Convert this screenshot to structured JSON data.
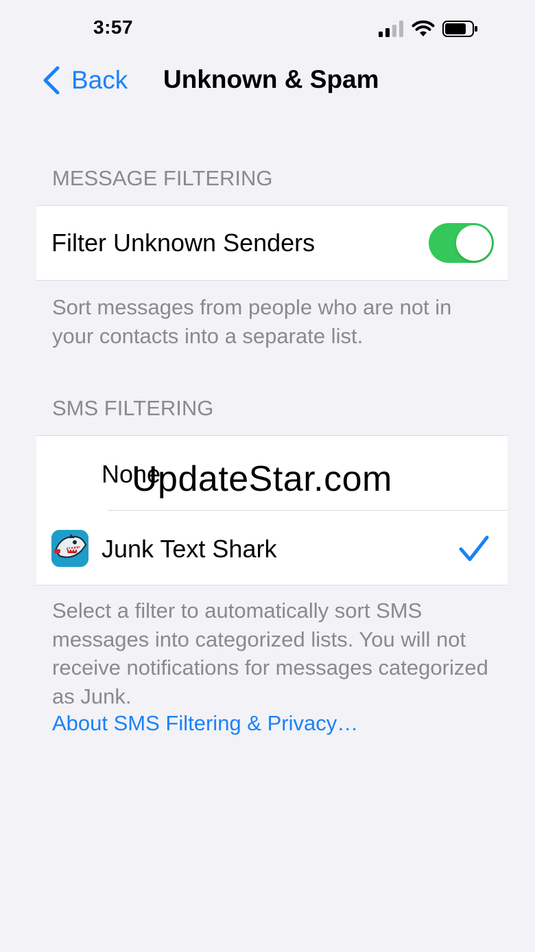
{
  "status_bar": {
    "time": "3:57"
  },
  "nav": {
    "back_label": "Back",
    "title": "Unknown & Spam"
  },
  "message_filtering": {
    "header": "MESSAGE FILTERING",
    "filter_unknown_label": "Filter Unknown Senders",
    "filter_unknown_enabled": true,
    "footer": "Sort messages from people who are not in your contacts into a separate list."
  },
  "sms_filtering": {
    "header": "SMS FILTERING",
    "options": [
      {
        "label": "None",
        "selected": false
      },
      {
        "label": "Junk Text Shark",
        "selected": true,
        "icon": "junk-text-shark-app-icon"
      }
    ],
    "footer": "Select a filter to automatically sort SMS messages into categorized lists. You will not receive notifications for messages categorized as Junk.",
    "link_label": "About SMS Filtering & Privacy…"
  },
  "watermark": "UpdateStar.com",
  "colors": {
    "accent": "#1a82f7",
    "toggle_on": "#34c759",
    "background": "#f2f2f7",
    "secondary_text": "#8a8a8e"
  }
}
